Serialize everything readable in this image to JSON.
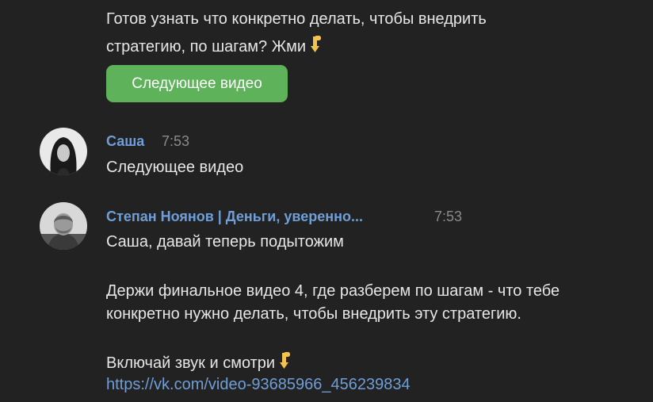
{
  "top_message": {
    "line1": "Готов узнать что конкретно делать, чтобы внедрить",
    "line2": "стратегию, по шагам? Жми",
    "line2_emoji": "point-down-emoji",
    "button_label": "Следующее видео"
  },
  "messages": [
    {
      "author": "Саша",
      "time": "7:53",
      "avatar": "user-avatar-sasha",
      "lines": [
        "Следующее видео"
      ]
    },
    {
      "author": "Степан Ноянов | Деньги, уверенно...",
      "time": "7:53",
      "avatar": "user-avatar-stepan",
      "lines": [
        "Саша, давай теперь подытожим",
        "Держи финальное видео 4, где разберем по шагам - что тебе",
        "конкретно нужно делать, чтобы внедрить эту стратегию.",
        "Включай звук и смотри"
      ],
      "last_line_emoji": "point-down-emoji",
      "link": "https://vk.com/video-93685966_456239834"
    }
  ],
  "colors": {
    "background": "#222222",
    "button": "#5eb25a",
    "author": "#6f9ed8",
    "link": "#6f9ed8",
    "time": "#8a8a8a"
  }
}
